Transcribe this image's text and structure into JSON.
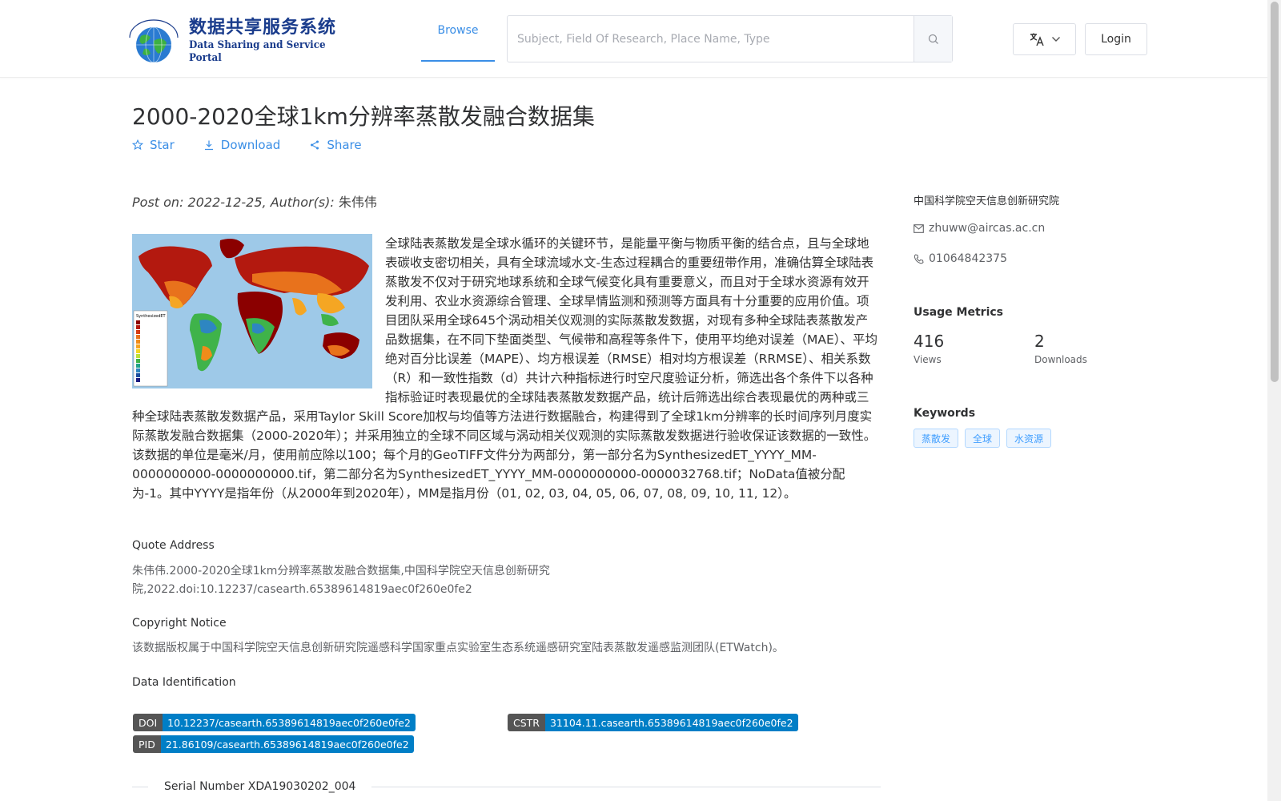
{
  "header": {
    "logo_cn": "数据共享服务系统",
    "logo_en": "Data Sharing and Service Portal",
    "nav_browse": "Browse",
    "search_placeholder": "Subject, Field Of Research, Place Name, Type",
    "login_label": "Login"
  },
  "dataset": {
    "title": "2000-2020全球1km分辨率蒸散发融合数据集",
    "actions": {
      "star": "Star",
      "download": "Download",
      "share": "Share"
    },
    "post_on": "Post on: 2022-12-25, Author(s): ",
    "author": "朱伟伟",
    "description": "全球陆表蒸散发是全球水循环的关键环节，是能量平衡与物质平衡的结合点，且与全球地表碳收支密切相关，具有全球流域水文-生态过程耦合的重要纽带作用，准确估算全球陆表蒸散发不仅对于研究地球系统和全球气候变化具有重要意义，而且对于全球水资源有效开发利用、农业水资源综合管理、全球旱情监测和预测等方面具有十分重要的应用价值。项目团队采用全球645个涡动相关仪观测的实际蒸散发数据，对现有多种全球陆表蒸散发产品数据集，在不同下垫面类型、气候带和高程等条件下，使用平均绝对误差（MAE）、平均绝对百分比误差（MAPE）、均方根误差（RMSE）相对均方根误差（RRMSE）、相关系数（R）和一致性指数（d）共计六种指标进行时空尺度验证分析，筛选出各个条件下以各种指标验证时表现最优的全球陆表蒸散发数据产品，统计后筛选出综合表现最优的两种或三种全球陆表蒸散发数据产品，采用Taylor Skill Score加权与均值等方法进行数据融合，构建得到了全球1km分辨率的长时间序列月度实际蒸散发融合数据集（2000-2020年）；并采用独立的全球不同区域与涡动相关仪观测的实际蒸散发数据进行验收保证该数据的一致性。该数据的单位是毫米/月，使用前应除以100；每个月的GeoTIFF文件分为两部分，第一部分名为SynthesizedET_YYYY_MM-0000000000-0000000000.tif，第二部分名为SynthesizedET_YYYY_MM-0000000000-0000032768.tif；NoData值被分配为-1。其中YYYY是指年份（从2000年到2020年），MM是指月份（01, 02, 03, 04, 05, 06, 07, 08, 09, 10, 11, 12）。",
    "map_legend_title": "SynthesizedET",
    "quote_title": "Quote Address",
    "quote_text": "朱伟伟.2000-2020全球1km分辨率蒸散发融合数据集,中国科学院空天信息创新研究院,2022.doi:10.12237/casearth.65389614819aec0f260e0fe2",
    "copyright_title": "Copyright Notice",
    "copyright_text": "该数据版权属于中国科学院空天信息创新研究院遥感科学国家重点实验室生态系统遥感研究室陆表蒸散发遥感监测团队(ETWatch)。",
    "ident_title": "Data Identification",
    "ident": {
      "doi_key": "DOI",
      "doi_val": "10.12237/casearth.65389614819aec0f260e0fe2",
      "cstr_key": "CSTR",
      "cstr_val": "31104.11.casearth.65389614819aec0f260e0fe2",
      "pid_key": "PID",
      "pid_val": "21.86109/casearth.65389614819aec0f260e0fe2"
    },
    "serial": "Serial Number XDA19030202_004"
  },
  "sidebar": {
    "org": "中国科学院空天信息创新研究院",
    "email": "zhuww@aircas.ac.cn",
    "phone": "01064842375",
    "usage_title": "Usage Metrics",
    "views_num": "416",
    "views_label": "Views",
    "downloads_num": "2",
    "downloads_label": "Downloads",
    "keywords_title": "Keywords",
    "keywords": [
      "蒸散发",
      "全球",
      "水资源"
    ]
  },
  "colors": {
    "accent": "#3a8ee6",
    "badge_key": "#555555",
    "badge_val": "#007ec6"
  }
}
